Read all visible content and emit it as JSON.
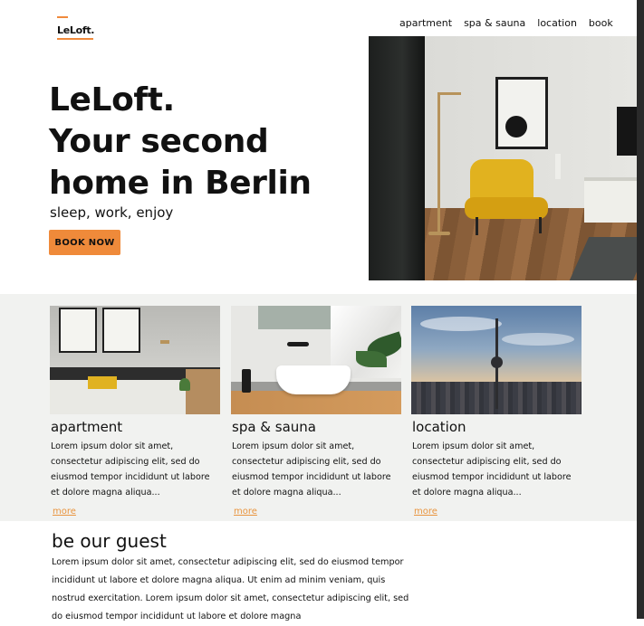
{
  "header": {
    "logo_text": "LeLoft.",
    "nav": [
      "apartment",
      "spa & sauna",
      "location",
      "book"
    ]
  },
  "hero": {
    "title_lines": [
      "LeLoft.",
      "Your second",
      "home in Berlin"
    ],
    "subtitle": "sleep, work, enjoy",
    "cta_label": "BOOK NOW"
  },
  "features": [
    {
      "title": "apartment",
      "text": "Lorem ipsum dolor sit amet, consectetur adipiscing elit, sed do eiusmod tempor incididunt ut labore et dolore magna aliqua...",
      "more": "more"
    },
    {
      "title": "spa & sauna",
      "text": "Lorem ipsum dolor sit amet, consectetur adipiscing elit, sed do eiusmod tempor incididunt ut labore et dolore magna aliqua...",
      "more": "more"
    },
    {
      "title": "location",
      "text": "Lorem ipsum dolor sit amet, consectetur adipiscing elit, sed do eiusmod tempor incididunt ut labore et dolore magna aliqua...",
      "more": "more"
    }
  ],
  "guest": {
    "title": "be our guest",
    "text": "Lorem ipsum dolor sit amet, consectetur adipiscing elit, sed do eiusmod tempor incididunt ut labore et dolore magna aliqua. Ut enim ad minim veniam, quis nostrud exercitation. Lorem ipsum dolor sit amet, consectetur adipiscing elit, sed do eiusmod tempor incididunt ut labore et dolore magna"
  },
  "colors": {
    "accent": "#ef8a3a",
    "band_background": "#f1f2f0",
    "text": "#111111"
  }
}
